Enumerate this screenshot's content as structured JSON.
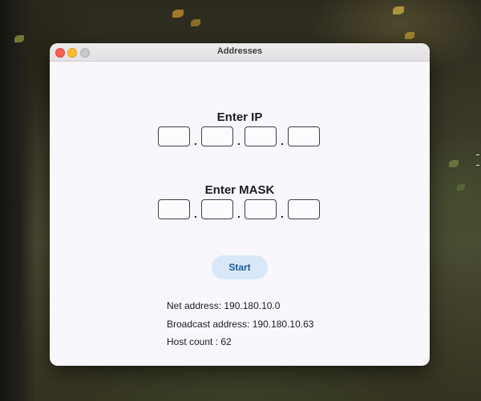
{
  "window": {
    "title": "Addresses"
  },
  "ip_section": {
    "heading": "Enter IP",
    "octets": [
      "",
      "",
      "",
      ""
    ],
    "separator": "."
  },
  "mask_section": {
    "heading": "Enter MASK",
    "octets": [
      "",
      "",
      "",
      ""
    ],
    "separator": "."
  },
  "start_button": {
    "label": "Start"
  },
  "results": {
    "net_address": "Net address: 190.180.10.0",
    "broadcast_address": "Broadcast address: 190.180.10.63",
    "host_count": "Host count : 62"
  },
  "colors": {
    "window_bg": "#f9f7fc",
    "button_bg": "#d8e8f8",
    "button_text": "#1c5a98",
    "close": "#fe5f57",
    "minimize": "#febc2e",
    "maximize_disabled": "#c9c7c9"
  }
}
